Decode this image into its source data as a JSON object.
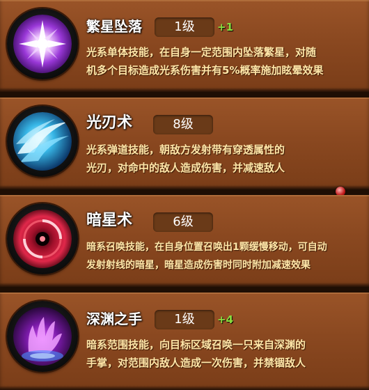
{
  "skills": [
    {
      "name": "繁星坠落",
      "level": "1级",
      "bonus": "+1",
      "desc_line1": "光系单体技能，在自身一定范围内坠落繁星，对随",
      "desc_line2": "机多个目标造成光系伤害并有5%概率施加眩晕效果",
      "icon": "starburst-icon"
    },
    {
      "name": "光刃术",
      "level": "8级",
      "bonus": "",
      "desc_line1": "光系弹道技能，朝敌方发射带有穿透属性的",
      "desc_line2": "光刃，对命中的敌人造成伤害，并减速敌人",
      "icon": "light-blade-icon"
    },
    {
      "name": "暗星术",
      "level": "6级",
      "bonus": "",
      "desc_line1": "暗系召唤技能，在自身位置召唤出1颗缓慢移动，可自动",
      "desc_line2": "发射射线的暗星，暗星造成伤害时同时附加减速效果",
      "icon": "dark-star-icon"
    },
    {
      "name": "深渊之手",
      "level": "1级",
      "bonus": "+4",
      "desc_line1": "暗系范围技能，向目标区域召唤一只来自深渊的",
      "desc_line2": "手掌，对范围内敌人造成一次伤害，并禁锢敌人",
      "icon": "abyss-hand-icon"
    }
  ],
  "colors": {
    "card": "#8a4820",
    "desc_text": "#ffe6a8",
    "bonus_text": "#88e040",
    "level_pill": "#6a3a18"
  }
}
